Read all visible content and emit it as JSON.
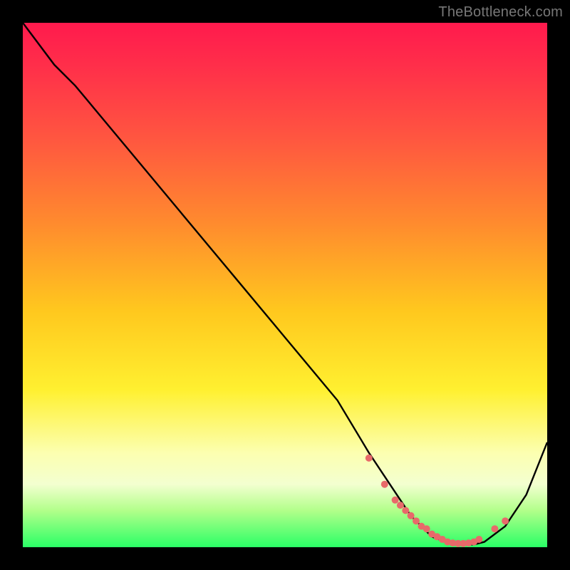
{
  "watermark": "TheBottleneck.com",
  "colors": {
    "frame": "#000000",
    "curve": "#000000",
    "dots": "#e86a6a",
    "gradient_stops": [
      "#ff1a4d",
      "#ff2e4a",
      "#ff5640",
      "#ff8a2e",
      "#ffc81e",
      "#fff030",
      "#fcffb0",
      "#f3ffd0",
      "#b2ff8a",
      "#2aff66"
    ]
  },
  "chart_data": {
    "type": "line",
    "title": "",
    "xlabel": "",
    "ylabel": "",
    "xlim": [
      0,
      100
    ],
    "ylim": [
      0,
      100
    ],
    "grid": false,
    "legend": false,
    "series": [
      {
        "name": "bottleneck-curve",
        "x": [
          0,
          6,
          10,
          20,
          30,
          40,
          50,
          60,
          66,
          70,
          74,
          78,
          82,
          86,
          88,
          92,
          96,
          100
        ],
        "y": [
          100,
          92,
          88,
          76,
          64,
          52,
          40,
          28,
          18,
          12,
          6,
          2,
          0.5,
          0.5,
          1,
          4,
          10,
          20
        ]
      }
    ],
    "dots": {
      "name": "sample-points",
      "x": [
        66,
        69,
        71,
        72,
        73,
        74,
        75,
        76,
        77,
        78,
        79,
        80,
        81,
        82,
        83,
        84,
        85,
        86,
        87,
        90,
        92
      ],
      "y": [
        17,
        12,
        9,
        8,
        7,
        6,
        5,
        4,
        3.5,
        2.5,
        2,
        1.5,
        1,
        0.8,
        0.7,
        0.7,
        0.8,
        1,
        1.5,
        3.5,
        5
      ],
      "r": 5
    }
  }
}
